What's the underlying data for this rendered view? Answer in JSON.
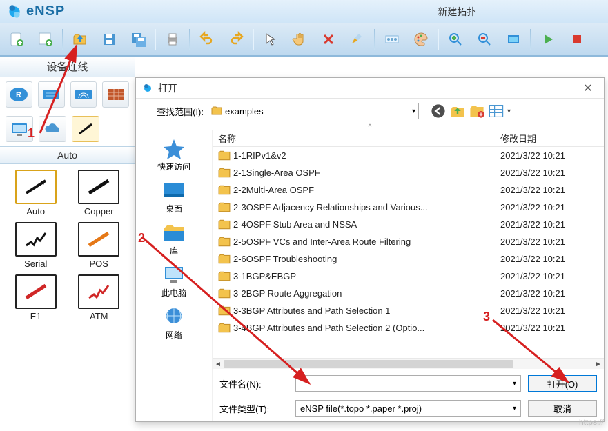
{
  "app": {
    "name": "eNSP",
    "title_extra": "新建拓扑"
  },
  "panel": {
    "title": "设备连线",
    "auto_title": "Auto",
    "cables": [
      "Auto",
      "Copper",
      "Serial",
      "POS",
      "E1",
      "ATM"
    ]
  },
  "annotations": {
    "a1": "1",
    "a2": "2",
    "a3": "3"
  },
  "dialog": {
    "title": "打开",
    "look_label": "查找范围(I):",
    "current_folder": "examples",
    "places": [
      "快速访问",
      "桌面",
      "库",
      "此电脑",
      "网络"
    ],
    "columns": {
      "name": "名称",
      "date": "修改日期"
    },
    "files": [
      {
        "name": "1-1RIPv1&v2",
        "date": "2021/3/22 10:21"
      },
      {
        "name": "2-1Single-Area OSPF",
        "date": "2021/3/22 10:21"
      },
      {
        "name": "2-2Multi-Area OSPF",
        "date": "2021/3/22 10:21"
      },
      {
        "name": "2-3OSPF Adjacency Relationships and Various...",
        "date": "2021/3/22 10:21"
      },
      {
        "name": "2-4OSPF Stub Area and NSSA",
        "date": "2021/3/22 10:21"
      },
      {
        "name": "2-5OSPF VCs and Inter-Area Route Filtering",
        "date": "2021/3/22 10:21"
      },
      {
        "name": "2-6OSPF Troubleshooting",
        "date": "2021/3/22 10:21"
      },
      {
        "name": "3-1BGP&EBGP",
        "date": "2021/3/22 10:21"
      },
      {
        "name": "3-2BGP Route Aggregation",
        "date": "2021/3/22 10:21"
      },
      {
        "name": "3-3BGP Attributes and Path Selection 1",
        "date": "2021/3/22 10:21"
      },
      {
        "name": "3-4BGP Attributes and Path Selection 2 (Optio...",
        "date": "2021/3/22 10:21"
      }
    ],
    "filename_label": "文件名(N):",
    "filetype_label": "文件类型(T):",
    "filetype_value": "eNSP file(*.topo *.paper *.proj)",
    "open_btn": "打开(O)",
    "cancel_btn": "取消"
  },
  "watermark": "https://"
}
